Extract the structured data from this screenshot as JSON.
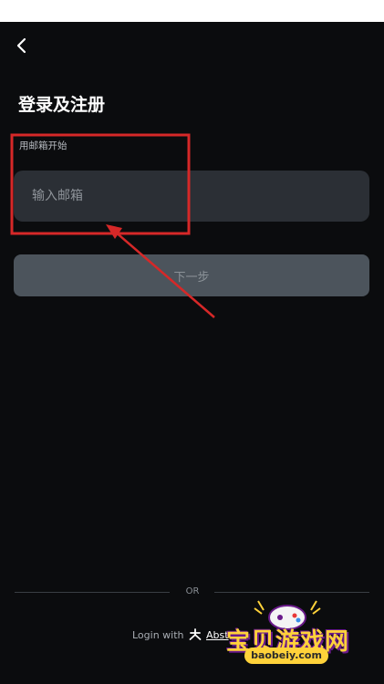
{
  "header": {
    "title": "登录及注册"
  },
  "form": {
    "hint": "用邮箱开始",
    "email_placeholder": "输入邮箱",
    "next_label": "下一步"
  },
  "footer": {
    "divider_text": "OR",
    "login_with": "Login with",
    "provider": "Abst"
  },
  "watermark": {
    "title": "宝贝游戏网",
    "url": "baobeiy.com"
  },
  "colors": {
    "background": "#0b0c0e",
    "input_bg": "#2b2f35",
    "button_bg": "#4c545c",
    "annotation": "#d62828"
  },
  "icons": {
    "back": "chevron-left-icon",
    "provider": "abstract-logo-icon"
  }
}
